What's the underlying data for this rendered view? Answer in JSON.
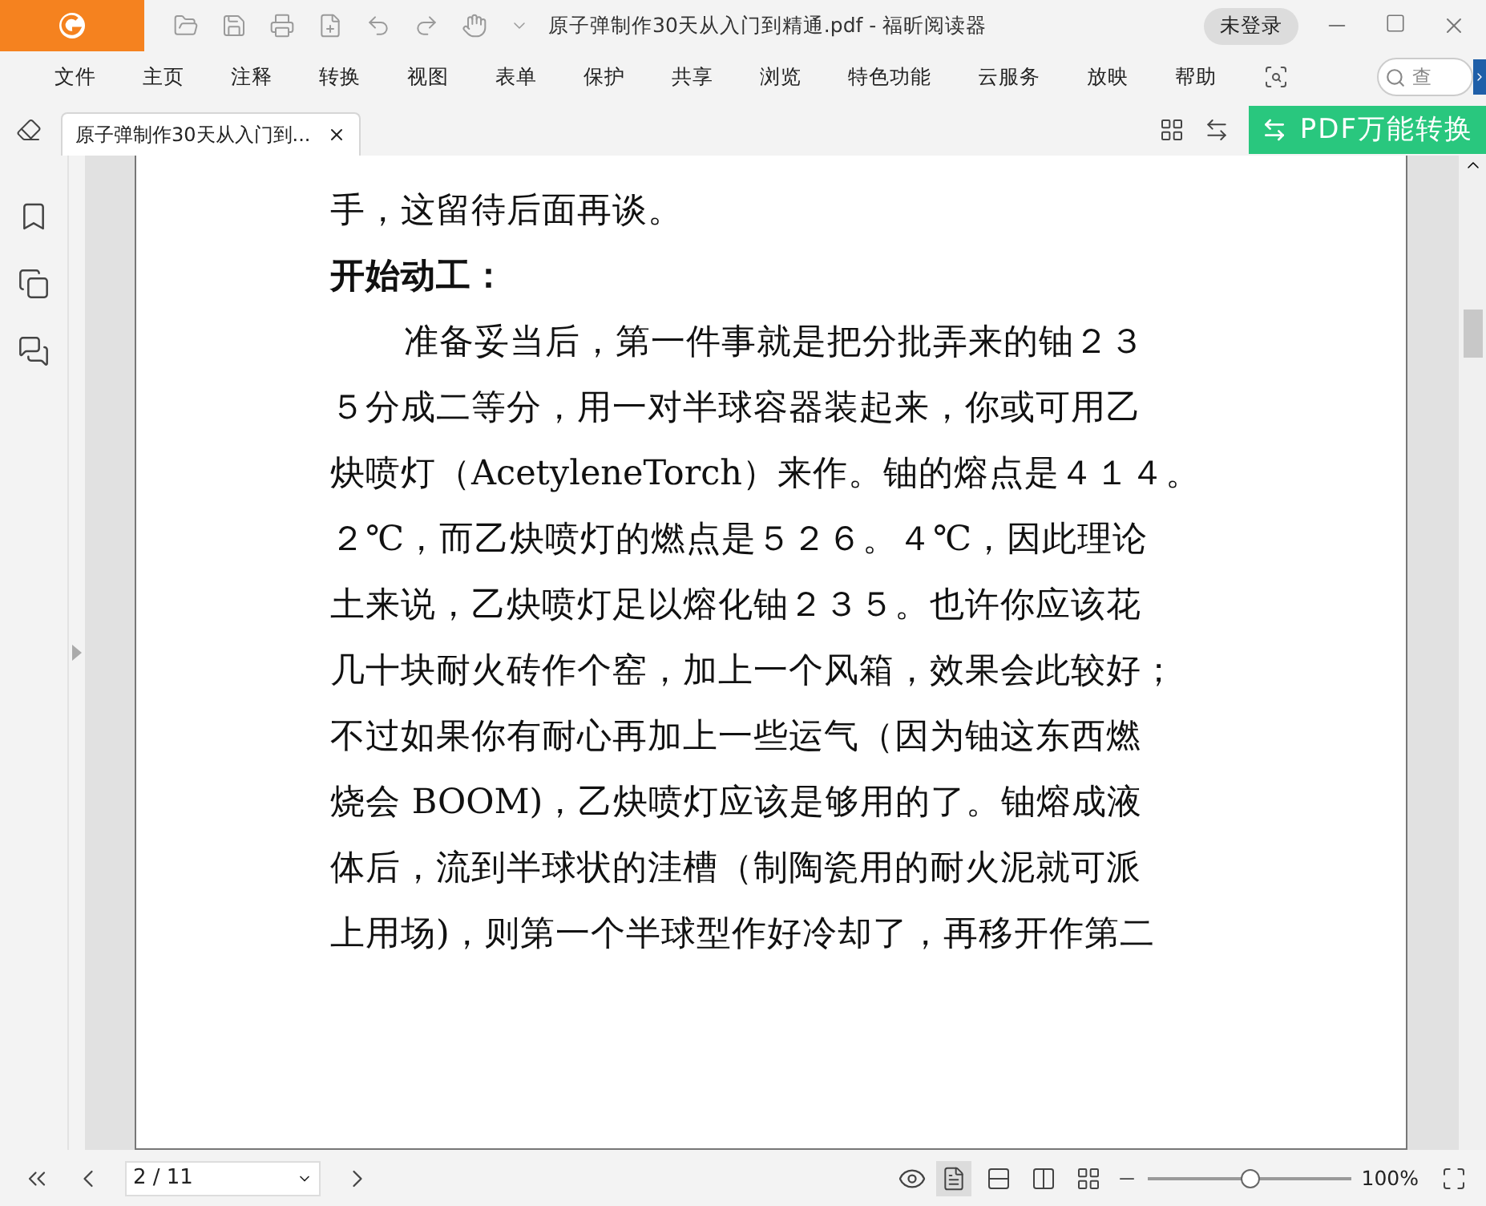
{
  "window": {
    "title": "原子弹制作30天从入门到精通.pdf - 福昕阅读器",
    "login": "未登录"
  },
  "menu": [
    "文件",
    "主页",
    "注释",
    "转换",
    "视图",
    "表单",
    "保护",
    "共享",
    "浏览",
    "特色功能",
    "云服务",
    "放映",
    "帮助"
  ],
  "search": {
    "placeholder": "查"
  },
  "tabs": [
    {
      "label": "原子弹制作30天从入门到...",
      "selected": true
    }
  ],
  "convert_button": "PDF万能转换",
  "page": {
    "lines": [
      {
        "kind": "text",
        "text": "手，这留待后面再谈。"
      },
      {
        "kind": "heading",
        "text": "开始动工："
      },
      {
        "kind": "indent",
        "text": "准备妥当后，第一件事就是把分批弄来的铀２３"
      },
      {
        "kind": "text",
        "text": "５分成二等分，用一对半球容器装起来，你或可用乙"
      },
      {
        "kind": "text",
        "text": "炔喷灯（AcetyleneTorch）来作。铀的熔点是４１４。"
      },
      {
        "kind": "text",
        "text": "２℃，而乙炔喷灯的燃点是５２６。４℃，因此理论"
      },
      {
        "kind": "text",
        "text": "土来说，乙炔喷灯足以熔化铀２３５。也许你应该花"
      },
      {
        "kind": "text",
        "text": "几十块耐火砖作个窑，加上一个风箱，效果会此较好；"
      },
      {
        "kind": "text",
        "text": "不过如果你有耐心再加上一些运气（因为铀这东西燃"
      },
      {
        "kind": "text",
        "text": "烧会 BOOM)，乙炔喷灯应该是够用的了。铀熔成液"
      },
      {
        "kind": "text",
        "text": "体后，流到半球状的洼槽（制陶瓷用的耐火泥就可派"
      },
      {
        "kind": "text",
        "text": "上用场)，则第一个半球型作好冷却了，再移开作第二"
      }
    ]
  },
  "status_bar": {
    "page_field": "2 / 11",
    "view_modes": [
      {
        "selected": true
      },
      {
        "selected": false
      },
      {
        "selected": false
      },
      {
        "selected": false
      }
    ],
    "zoom": {
      "level": 0.5,
      "reading": "100%"
    }
  }
}
